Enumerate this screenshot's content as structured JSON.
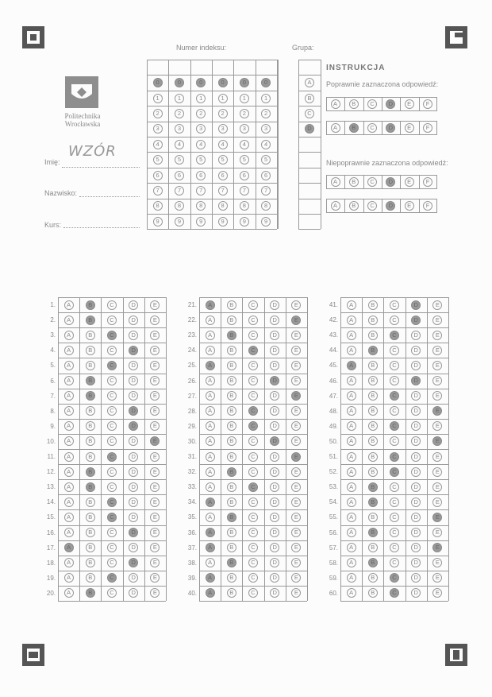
{
  "header": {
    "index_label": "Numer indeksu:",
    "group_label": "Grupa:",
    "university_line1": "Politechnika",
    "university_line2": "Wrocławska"
  },
  "personal": {
    "name_label": "Imię:",
    "name_value": "WZÓR",
    "surname_label": "Nazwisko:",
    "course_label": "Kurs:"
  },
  "index_grid": {
    "digits": [
      "0",
      "1",
      "2",
      "3",
      "4",
      "5",
      "6",
      "7",
      "8",
      "9"
    ],
    "columns": 6
  },
  "group_options": [
    "A",
    "B",
    "C",
    "D"
  ],
  "instructions": {
    "title": "INSTRUKCJA",
    "correct_label": "Poprawnie zaznaczona odpowiedź:",
    "incorrect_label": "Niepoprawnie zaznaczona odpowiedź:",
    "options": [
      "A",
      "B",
      "C",
      "D",
      "E",
      "F"
    ]
  },
  "answers": {
    "options": [
      "A",
      "B",
      "C",
      "D",
      "E"
    ],
    "marked": [
      "B",
      "B",
      "C",
      "D",
      "C",
      "B",
      "B",
      "D",
      "D",
      "E",
      "C",
      "B",
      "B",
      "C",
      "C",
      "D",
      "A",
      "D",
      "C",
      "B",
      "A",
      "E",
      "B",
      "C",
      "A",
      "D",
      "E",
      "C",
      "C",
      "D",
      "E",
      "B",
      "C",
      "A",
      "B",
      "A",
      "A",
      "B",
      "A",
      "A",
      "D",
      "D",
      "C",
      "B",
      "A",
      "D",
      "C",
      "E",
      "C",
      "E",
      "C",
      "C",
      "B",
      "B",
      "E",
      "B",
      "E",
      "B",
      "C",
      "C"
    ]
  },
  "colors": {
    "ink": "#999999",
    "fill": "#9a9a9a",
    "marker": "#555555"
  }
}
